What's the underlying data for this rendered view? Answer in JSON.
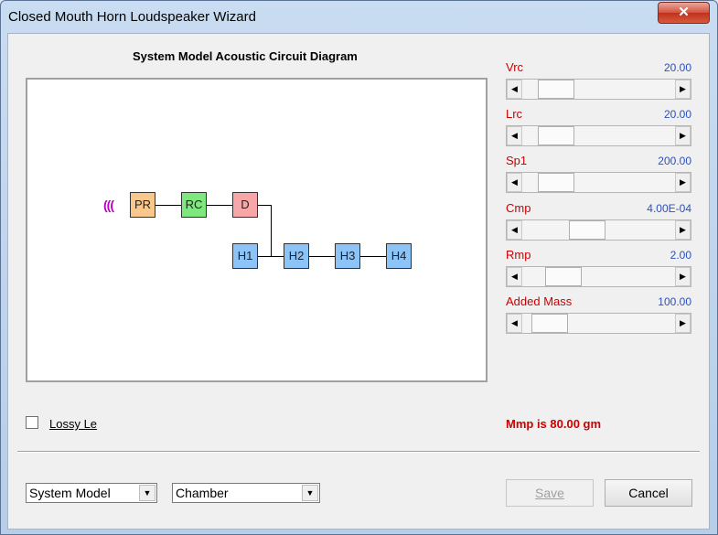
{
  "window": {
    "title": "Closed Mouth Horn Loudspeaker Wizard",
    "close_glyph": "✕"
  },
  "diagram": {
    "title": "System Model Acoustic Circuit Diagram",
    "source_glyph": "(((",
    "blocks": {
      "pr": {
        "label": "PR",
        "color": "#f8c88c"
      },
      "rc": {
        "label": "RC",
        "color": "#7ee87e"
      },
      "d": {
        "label": "D",
        "color": "#f7a7a7"
      },
      "h1": {
        "label": "H1",
        "color": "#8cc4f8"
      },
      "h2": {
        "label": "H2",
        "color": "#8cc4f8"
      },
      "h3": {
        "label": "H3",
        "color": "#8cc4f8"
      },
      "h4": {
        "label": "H4",
        "color": "#8cc4f8"
      }
    }
  },
  "sliders": [
    {
      "label": "Vrc",
      "value": "20.00",
      "level": 0.13
    },
    {
      "label": "Lrc",
      "value": "20.00",
      "level": 0.13
    },
    {
      "label": "Sp1",
      "value": "200.00",
      "level": 0.13
    },
    {
      "label": "Cmp",
      "value": "4.00E-04",
      "level": 0.4
    },
    {
      "label": "Rmp",
      "value": "2.00",
      "level": 0.2
    },
    {
      "label": "Added Mass",
      "value": "100.00",
      "level": 0.08
    }
  ],
  "lossy": {
    "label": "Lossy Le",
    "checked": false
  },
  "mmp_text": "Mmp is 80.00 gm",
  "model_select": {
    "value": "System Model"
  },
  "chamber_select": {
    "value": "Chamber"
  },
  "buttons": {
    "save": "Save",
    "cancel": "Cancel"
  },
  "icons": {
    "left_arrow": "◀",
    "right_arrow": "▶",
    "dropdown": "▼"
  }
}
